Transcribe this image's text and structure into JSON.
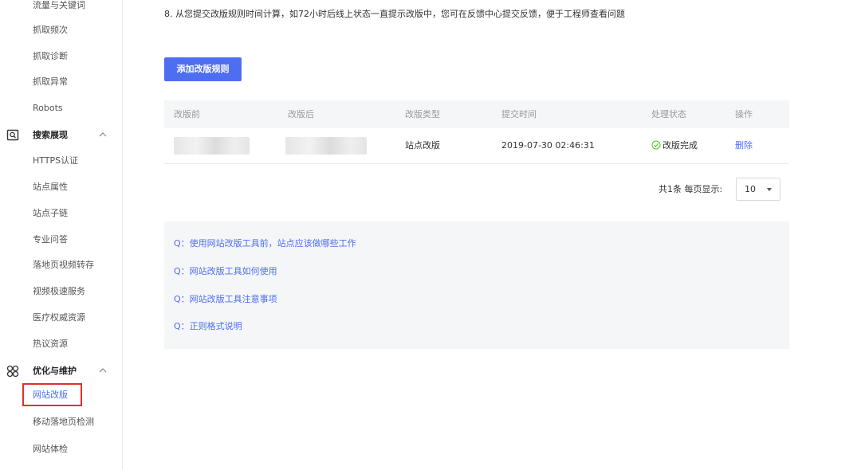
{
  "sidebar": {
    "items_top": [
      {
        "label": "流量与关键词"
      },
      {
        "label": "抓取频次"
      },
      {
        "label": "抓取诊断"
      },
      {
        "label": "抓取异常"
      },
      {
        "label": "Robots"
      }
    ],
    "section_search": {
      "label": "搜索展现",
      "icon": "search-display-icon",
      "caret": "chevron-up-icon"
    },
    "items_search": [
      {
        "label": "HTTPS认证"
      },
      {
        "label": "站点属性"
      },
      {
        "label": "站点子链"
      },
      {
        "label": "专业问答"
      },
      {
        "label": "落地页视频转存"
      },
      {
        "label": "视频极速服务"
      },
      {
        "label": "医疗权威资源"
      },
      {
        "label": "热议资源"
      }
    ],
    "section_optimize": {
      "label": "优化与维护",
      "icon": "optimize-icon",
      "caret": "chevron-up-icon"
    },
    "items_optimize": [
      {
        "label": "网站改版",
        "active": true
      },
      {
        "label": "移动落地页检测"
      },
      {
        "label": "网站体检"
      }
    ]
  },
  "main": {
    "notice": "8. 从您提交改版规则时间计算，如72小时后线上状态一直提示改版中，您可在反馈中心提交反馈，便于工程师查看问题",
    "add_button": "添加改版规则",
    "table": {
      "headers": [
        "改版前",
        "改版后",
        "改版类型",
        "提交时间",
        "处理状态",
        "操作"
      ],
      "rows": [
        {
          "type": "站点改版",
          "time": "2019-07-30 02:46:31",
          "status": "改版完成",
          "action": "删除"
        }
      ]
    },
    "pagination": {
      "summary": "共1条  每页显示:",
      "page_size": "10"
    },
    "faq": [
      "Q：使用网站改版工具前，站点应该做哪些工作",
      "Q：网站改版工具如何使用",
      "Q：网站改版工具注意事项",
      "Q：正则格式说明"
    ]
  },
  "colors": {
    "accent": "#4e6ef2",
    "highlight_border": "#e0302b",
    "success": "#52c41a"
  }
}
